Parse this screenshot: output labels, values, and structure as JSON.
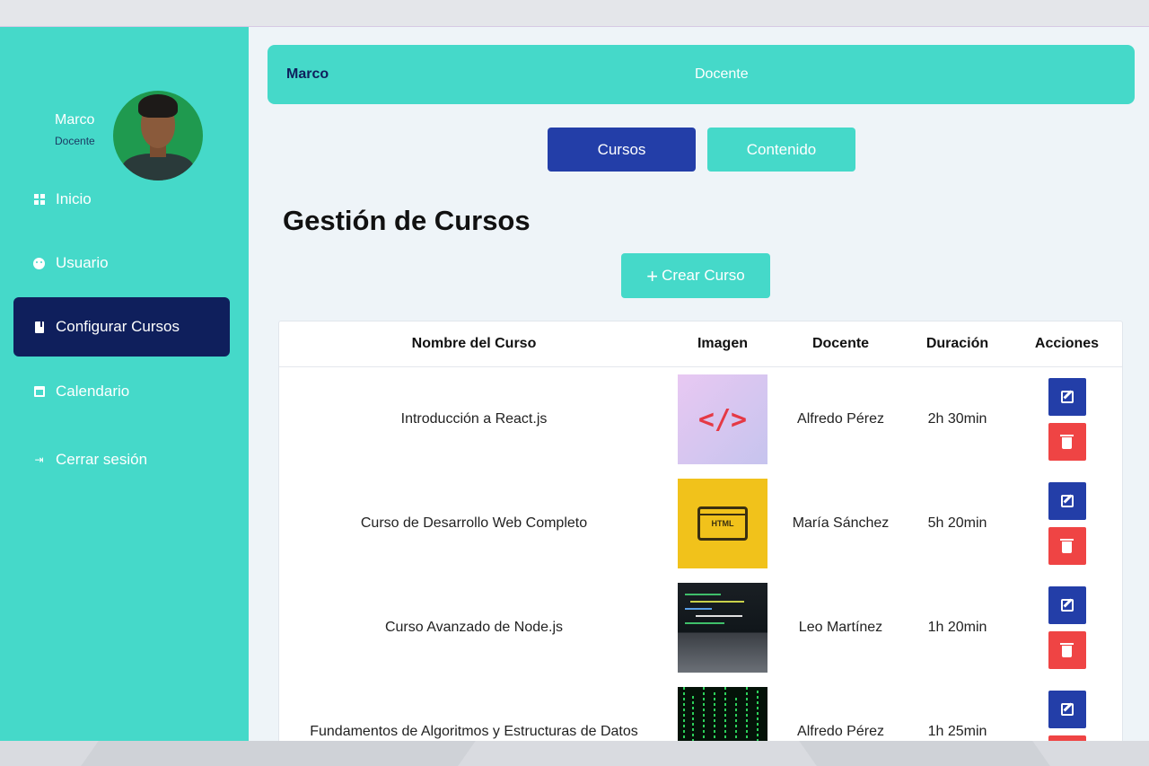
{
  "sidebar": {
    "profile": {
      "name": "Marco",
      "role": "Docente"
    },
    "items": [
      {
        "label": "Inicio",
        "icon": "dashboard-icon"
      },
      {
        "label": "Usuario",
        "icon": "user-icon"
      },
      {
        "label": "Configurar Cursos",
        "icon": "book-icon",
        "active": true
      },
      {
        "label": "Calendario",
        "icon": "calendar-icon"
      },
      {
        "label": "Cerrar sesión",
        "icon": "logout-icon"
      }
    ]
  },
  "header": {
    "user_name": "Marco",
    "role": "Docente"
  },
  "tabs": [
    {
      "label": "Cursos",
      "active": true
    },
    {
      "label": "Contenido",
      "active": false
    }
  ],
  "page": {
    "title": "Gestión de Cursos",
    "create_button": "Crear Curso"
  },
  "table": {
    "columns": [
      "Nombre del Curso",
      "Imagen",
      "Docente",
      "Duración",
      "Acciones"
    ],
    "rows": [
      {
        "nombre": "Introducción a React.js",
        "docente": "Alfredo Pérez",
        "duracion": "2h 30min"
      },
      {
        "nombre": "Curso de Desarrollo Web Completo",
        "docente": "María Sánchez",
        "duracion": "5h 20min"
      },
      {
        "nombre": "Curso Avanzado de Node.js",
        "docente": "Leo Martínez",
        "duracion": "1h 20min"
      },
      {
        "nombre": "Fundamentos de Algoritmos y Estructuras de Datos",
        "docente": "Alfredo Pérez",
        "duracion": "1h 25min"
      }
    ]
  },
  "thumbs": {
    "react_symbol": "</>",
    "html_label": "HTML"
  },
  "colors": {
    "accent": "#45d9c9",
    "primary": "#233ea8",
    "sidebar_active": "#0f1f5c",
    "danger": "#ef4444",
    "background": "#eef4f8"
  }
}
